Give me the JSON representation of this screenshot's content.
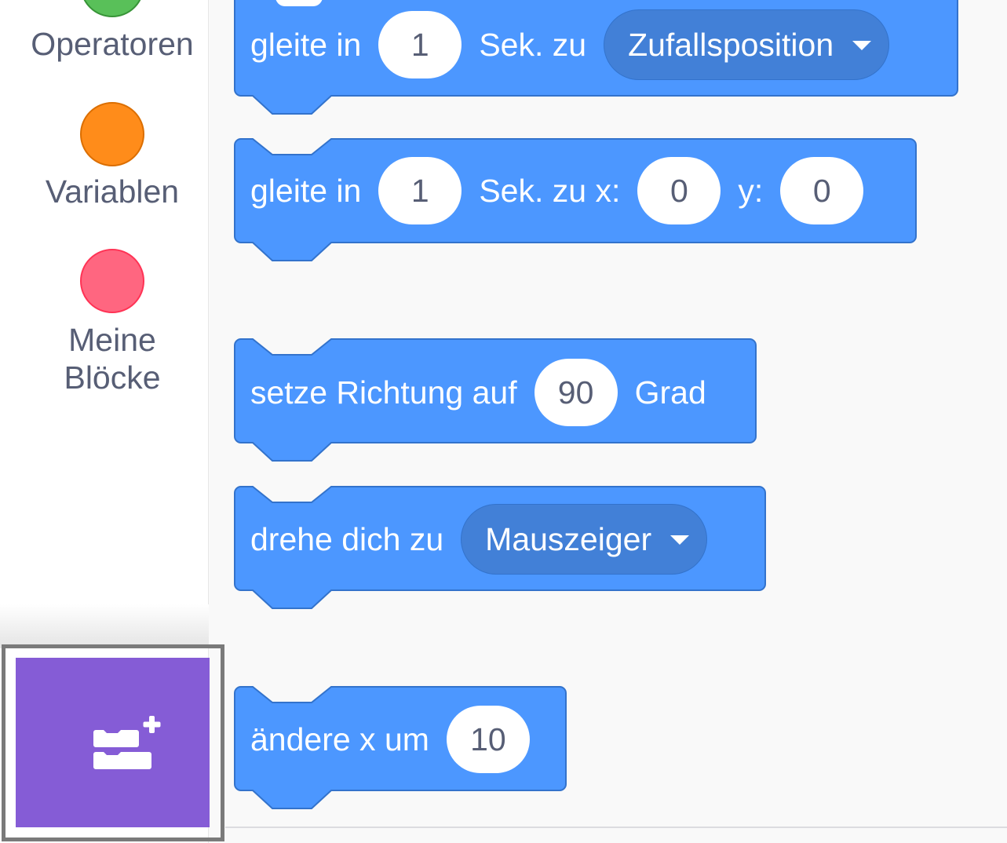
{
  "sidebar": {
    "categories": [
      {
        "label_line1": "Operatoren",
        "label_line2": "",
        "color": "#59c059",
        "border": "#389438",
        "icon": "operators-dot"
      },
      {
        "label_line1": "Variablen",
        "label_line2": "",
        "color": "#ff8c1a",
        "border": "#db6e00",
        "icon": "variables-dot"
      },
      {
        "label_line1": "Meine",
        "label_line2": "Blöcke",
        "color": "#ff6680",
        "border": "#ff3355",
        "icon": "my-blocks-dot"
      }
    ],
    "extension_button": {
      "icon": "add-extension-icon",
      "color": "#855cd6"
    }
  },
  "blocks": {
    "color": "#4c97ff",
    "border": "#3373cc",
    "glide_random": {
      "text1": "gleite in",
      "secs": "1",
      "text2": "Sek. zu",
      "target": "Zufallsposition"
    },
    "glide_xy": {
      "text1": "gleite in",
      "secs": "1",
      "text2": "Sek. zu x:",
      "x": "0",
      "text3": "y:",
      "y": "0"
    },
    "point_direction": {
      "text1": "setze Richtung auf",
      "degrees": "90",
      "text2": "Grad"
    },
    "point_towards": {
      "text1": "drehe dich zu",
      "target": "Mauszeiger"
    },
    "change_x": {
      "text1": "ändere x um",
      "value": "10"
    }
  }
}
